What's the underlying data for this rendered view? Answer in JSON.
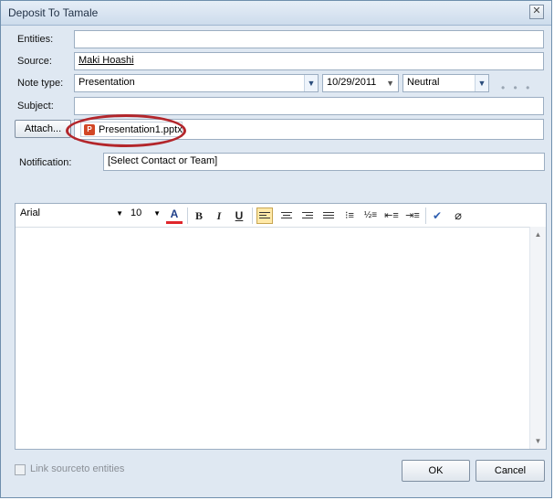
{
  "window": {
    "title": "Deposit To Tamale",
    "close_label": "✕"
  },
  "fields": {
    "entities_label": "Entities:",
    "entities_value": "",
    "source_label": "Source:",
    "source_value": "Maki Hoashi",
    "note_type_label": "Note type:",
    "note_type_value": "Presentation",
    "date_value": "10/29/2011",
    "sentiment_value": "Neutral",
    "more_dots": "• • •",
    "subject_label": "Subject:",
    "subject_value": "",
    "attach_button": "Attach...",
    "attachment_file": "Presentation1.pptx",
    "notification_label": "Notification:",
    "notification_value": "[Select Contact or Team]"
  },
  "editor": {
    "font_name": "Arial",
    "font_size": "10",
    "font_color_glyph": "A",
    "bold": "B",
    "italic": "I",
    "underline": "U",
    "body_text": ""
  },
  "footer": {
    "link_checkbox_label": "Link sourceto entities",
    "ok_button": "OK",
    "cancel_button": "Cancel"
  },
  "icons": {
    "dropdown": "chevron-down-icon",
    "file": "powerpoint-file-icon",
    "spellcheck": "spellcheck-icon",
    "attach": "paperclip-icon"
  },
  "colors": {
    "window_bg": "#dfe8f2",
    "highlight_oval": "#b3262b",
    "font_color_underline": "#e0262b"
  }
}
